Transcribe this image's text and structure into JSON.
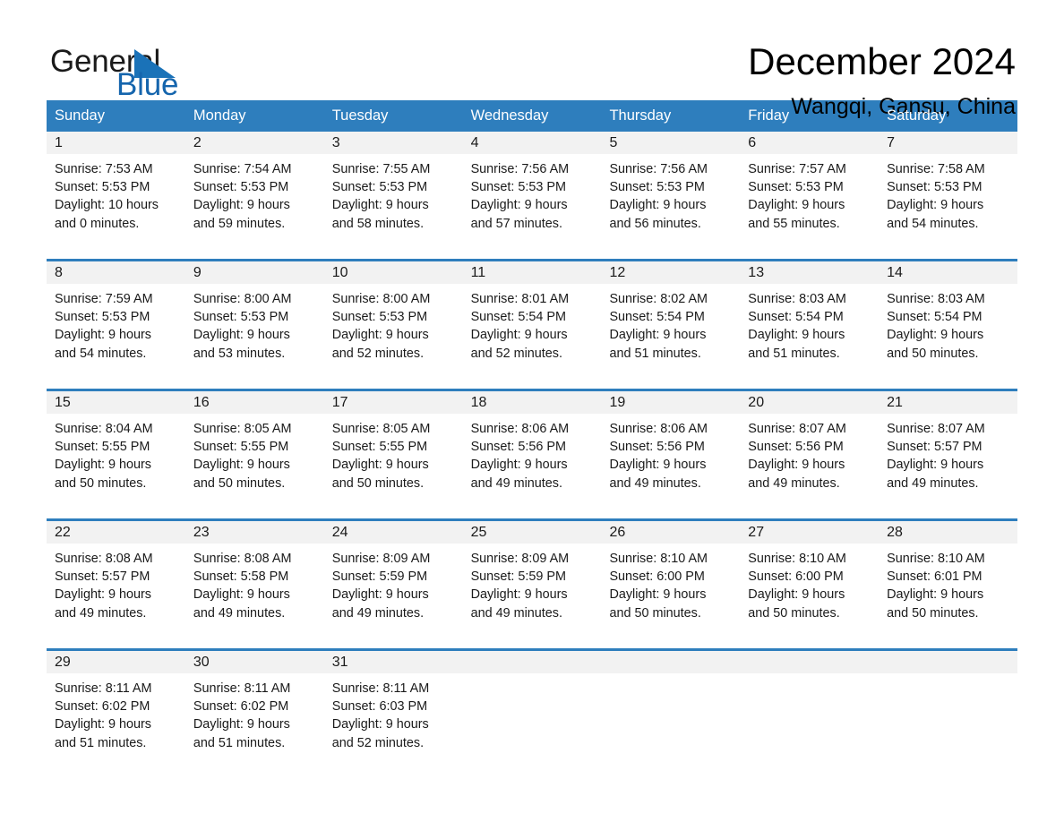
{
  "brand": {
    "name_part1": "General",
    "name_part2": "Blue",
    "logo_icon": "triangle-logo-icon",
    "accent_color": "#1565ad"
  },
  "header": {
    "month_title": "December 2024",
    "location": "Wangqi, Gansu, China"
  },
  "calendar": {
    "header_color": "#2e7ebd",
    "weekdays": [
      "Sunday",
      "Monday",
      "Tuesday",
      "Wednesday",
      "Thursday",
      "Friday",
      "Saturday"
    ],
    "weeks": [
      [
        {
          "day": "1",
          "sunrise": "Sunrise: 7:53 AM",
          "sunset": "Sunset: 5:53 PM",
          "daylight_line1": "Daylight: 10 hours",
          "daylight_line2": "and 0 minutes."
        },
        {
          "day": "2",
          "sunrise": "Sunrise: 7:54 AM",
          "sunset": "Sunset: 5:53 PM",
          "daylight_line1": "Daylight: 9 hours",
          "daylight_line2": "and 59 minutes."
        },
        {
          "day": "3",
          "sunrise": "Sunrise: 7:55 AM",
          "sunset": "Sunset: 5:53 PM",
          "daylight_line1": "Daylight: 9 hours",
          "daylight_line2": "and 58 minutes."
        },
        {
          "day": "4",
          "sunrise": "Sunrise: 7:56 AM",
          "sunset": "Sunset: 5:53 PM",
          "daylight_line1": "Daylight: 9 hours",
          "daylight_line2": "and 57 minutes."
        },
        {
          "day": "5",
          "sunrise": "Sunrise: 7:56 AM",
          "sunset": "Sunset: 5:53 PM",
          "daylight_line1": "Daylight: 9 hours",
          "daylight_line2": "and 56 minutes."
        },
        {
          "day": "6",
          "sunrise": "Sunrise: 7:57 AM",
          "sunset": "Sunset: 5:53 PM",
          "daylight_line1": "Daylight: 9 hours",
          "daylight_line2": "and 55 minutes."
        },
        {
          "day": "7",
          "sunrise": "Sunrise: 7:58 AM",
          "sunset": "Sunset: 5:53 PM",
          "daylight_line1": "Daylight: 9 hours",
          "daylight_line2": "and 54 minutes."
        }
      ],
      [
        {
          "day": "8",
          "sunrise": "Sunrise: 7:59 AM",
          "sunset": "Sunset: 5:53 PM",
          "daylight_line1": "Daylight: 9 hours",
          "daylight_line2": "and 54 minutes."
        },
        {
          "day": "9",
          "sunrise": "Sunrise: 8:00 AM",
          "sunset": "Sunset: 5:53 PM",
          "daylight_line1": "Daylight: 9 hours",
          "daylight_line2": "and 53 minutes."
        },
        {
          "day": "10",
          "sunrise": "Sunrise: 8:00 AM",
          "sunset": "Sunset: 5:53 PM",
          "daylight_line1": "Daylight: 9 hours",
          "daylight_line2": "and 52 minutes."
        },
        {
          "day": "11",
          "sunrise": "Sunrise: 8:01 AM",
          "sunset": "Sunset: 5:54 PM",
          "daylight_line1": "Daylight: 9 hours",
          "daylight_line2": "and 52 minutes."
        },
        {
          "day": "12",
          "sunrise": "Sunrise: 8:02 AM",
          "sunset": "Sunset: 5:54 PM",
          "daylight_line1": "Daylight: 9 hours",
          "daylight_line2": "and 51 minutes."
        },
        {
          "day": "13",
          "sunrise": "Sunrise: 8:03 AM",
          "sunset": "Sunset: 5:54 PM",
          "daylight_line1": "Daylight: 9 hours",
          "daylight_line2": "and 51 minutes."
        },
        {
          "day": "14",
          "sunrise": "Sunrise: 8:03 AM",
          "sunset": "Sunset: 5:54 PM",
          "daylight_line1": "Daylight: 9 hours",
          "daylight_line2": "and 50 minutes."
        }
      ],
      [
        {
          "day": "15",
          "sunrise": "Sunrise: 8:04 AM",
          "sunset": "Sunset: 5:55 PM",
          "daylight_line1": "Daylight: 9 hours",
          "daylight_line2": "and 50 minutes."
        },
        {
          "day": "16",
          "sunrise": "Sunrise: 8:05 AM",
          "sunset": "Sunset: 5:55 PM",
          "daylight_line1": "Daylight: 9 hours",
          "daylight_line2": "and 50 minutes."
        },
        {
          "day": "17",
          "sunrise": "Sunrise: 8:05 AM",
          "sunset": "Sunset: 5:55 PM",
          "daylight_line1": "Daylight: 9 hours",
          "daylight_line2": "and 50 minutes."
        },
        {
          "day": "18",
          "sunrise": "Sunrise: 8:06 AM",
          "sunset": "Sunset: 5:56 PM",
          "daylight_line1": "Daylight: 9 hours",
          "daylight_line2": "and 49 minutes."
        },
        {
          "day": "19",
          "sunrise": "Sunrise: 8:06 AM",
          "sunset": "Sunset: 5:56 PM",
          "daylight_line1": "Daylight: 9 hours",
          "daylight_line2": "and 49 minutes."
        },
        {
          "day": "20",
          "sunrise": "Sunrise: 8:07 AM",
          "sunset": "Sunset: 5:56 PM",
          "daylight_line1": "Daylight: 9 hours",
          "daylight_line2": "and 49 minutes."
        },
        {
          "day": "21",
          "sunrise": "Sunrise: 8:07 AM",
          "sunset": "Sunset: 5:57 PM",
          "daylight_line1": "Daylight: 9 hours",
          "daylight_line2": "and 49 minutes."
        }
      ],
      [
        {
          "day": "22",
          "sunrise": "Sunrise: 8:08 AM",
          "sunset": "Sunset: 5:57 PM",
          "daylight_line1": "Daylight: 9 hours",
          "daylight_line2": "and 49 minutes."
        },
        {
          "day": "23",
          "sunrise": "Sunrise: 8:08 AM",
          "sunset": "Sunset: 5:58 PM",
          "daylight_line1": "Daylight: 9 hours",
          "daylight_line2": "and 49 minutes."
        },
        {
          "day": "24",
          "sunrise": "Sunrise: 8:09 AM",
          "sunset": "Sunset: 5:59 PM",
          "daylight_line1": "Daylight: 9 hours",
          "daylight_line2": "and 49 minutes."
        },
        {
          "day": "25",
          "sunrise": "Sunrise: 8:09 AM",
          "sunset": "Sunset: 5:59 PM",
          "daylight_line1": "Daylight: 9 hours",
          "daylight_line2": "and 49 minutes."
        },
        {
          "day": "26",
          "sunrise": "Sunrise: 8:10 AM",
          "sunset": "Sunset: 6:00 PM",
          "daylight_line1": "Daylight: 9 hours",
          "daylight_line2": "and 50 minutes."
        },
        {
          "day": "27",
          "sunrise": "Sunrise: 8:10 AM",
          "sunset": "Sunset: 6:00 PM",
          "daylight_line1": "Daylight: 9 hours",
          "daylight_line2": "and 50 minutes."
        },
        {
          "day": "28",
          "sunrise": "Sunrise: 8:10 AM",
          "sunset": "Sunset: 6:01 PM",
          "daylight_line1": "Daylight: 9 hours",
          "daylight_line2": "and 50 minutes."
        }
      ],
      [
        {
          "day": "29",
          "sunrise": "Sunrise: 8:11 AM",
          "sunset": "Sunset: 6:02 PM",
          "daylight_line1": "Daylight: 9 hours",
          "daylight_line2": "and 51 minutes."
        },
        {
          "day": "30",
          "sunrise": "Sunrise: 8:11 AM",
          "sunset": "Sunset: 6:02 PM",
          "daylight_line1": "Daylight: 9 hours",
          "daylight_line2": "and 51 minutes."
        },
        {
          "day": "31",
          "sunrise": "Sunrise: 8:11 AM",
          "sunset": "Sunset: 6:03 PM",
          "daylight_line1": "Daylight: 9 hours",
          "daylight_line2": "and 52 minutes."
        },
        {
          "day": "",
          "sunrise": "",
          "sunset": "",
          "daylight_line1": "",
          "daylight_line2": ""
        },
        {
          "day": "",
          "sunrise": "",
          "sunset": "",
          "daylight_line1": "",
          "daylight_line2": ""
        },
        {
          "day": "",
          "sunrise": "",
          "sunset": "",
          "daylight_line1": "",
          "daylight_line2": ""
        },
        {
          "day": "",
          "sunrise": "",
          "sunset": "",
          "daylight_line1": "",
          "daylight_line2": ""
        }
      ]
    ]
  }
}
